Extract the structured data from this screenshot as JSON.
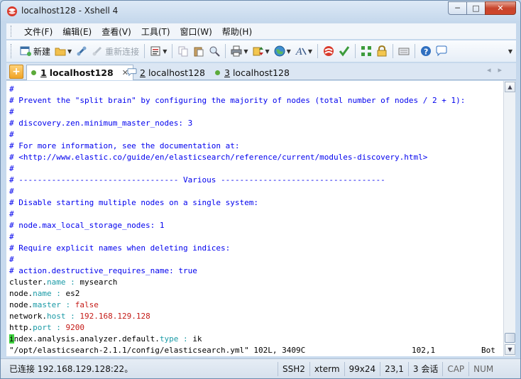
{
  "window": {
    "title": "localhost128 - Xshell 4",
    "buttons": {
      "minimize": "─",
      "maximize": "□",
      "close": "✕"
    }
  },
  "menu": [
    "文件(F)",
    "编辑(E)",
    "查看(V)",
    "工具(T)",
    "窗口(W)",
    "帮助(H)"
  ],
  "toolbar": {
    "new_label": "新建",
    "reconnect_label": "重新连接"
  },
  "tabs": [
    {
      "num": "1",
      "label": "localhost128",
      "active": true
    },
    {
      "num": "2",
      "label": "localhost128",
      "active": false
    },
    {
      "num": "3",
      "label": "localhost128",
      "active": false
    }
  ],
  "terminal": {
    "lines": [
      "#",
      "# Prevent the \"split brain\" by configuring the majority of nodes (total number of nodes / 2 + 1):",
      "#",
      "# discovery.zen.minimum_master_nodes: 3",
      "#",
      "# For more information, see the documentation at:",
      "# <http://www.elastic.co/guide/en/elasticsearch/reference/current/modules-discovery.html>",
      "#",
      "# ---------------------------------- Various -----------------------------------",
      "#",
      "# Disable starting multiple nodes on a single system:",
      "#",
      "# node.max_local_storage_nodes: 1",
      "#",
      "# Require explicit names when deleting indices:",
      "#",
      "# action.destructive_requires_name: true"
    ],
    "config": [
      {
        "prefix": "cluster.",
        "key": "name",
        "sep": " : ",
        "value": "mysearch",
        "value_color": "plain"
      },
      {
        "prefix": "node.",
        "key": "name",
        "sep": " : ",
        "value": "es2",
        "value_color": "plain"
      },
      {
        "prefix": "node.",
        "key": "master",
        "sep": " : ",
        "value": "false",
        "value_color": "red"
      },
      {
        "prefix": "network.",
        "key": "host",
        "sep": " : ",
        "value": "192.168.129.128",
        "value_color": "red"
      },
      {
        "prefix": "http.",
        "key": "port",
        "sep": " : ",
        "value": "9200",
        "value_color": "red"
      }
    ],
    "last_line": {
      "cursor_char": "i",
      "prefix": "ndex.analysis.analyzer.default.",
      "key": "type",
      "sep": " : ",
      "value": "ik"
    },
    "status_line": {
      "file": "\"/opt/elasticsearch-2.1.1/config/elasticsearch.yml\" 102L, 3409C",
      "position": "102,1",
      "scroll": "Bot"
    }
  },
  "statusbar": {
    "connection": "已连接 192.168.129.128:22。",
    "protocol": "SSH2",
    "terminal": "xterm",
    "size": "99x24",
    "cursor": "23,1",
    "sessions": "3 会话",
    "cap": "CAP",
    "num": "NUM"
  },
  "colors": {
    "comment": "#0000ee",
    "key": "#1a9aa6",
    "value": "#c41a16",
    "cursor": "#3fd13f"
  }
}
